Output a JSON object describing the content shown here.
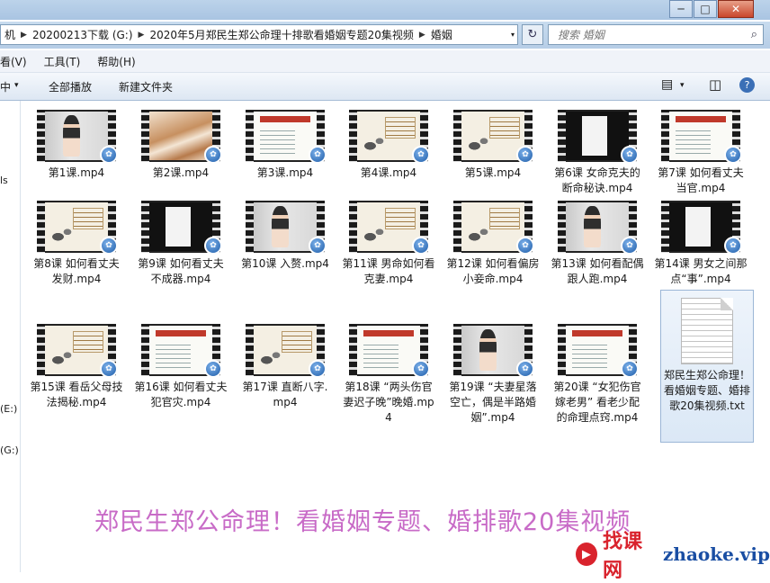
{
  "window": {
    "min_label": "─",
    "max_label": "□",
    "close_label": "✕"
  },
  "address": {
    "crumbs": [
      "机",
      "20200213下载 (G:)",
      "2020年5月郑民生郑公命理十排歌看婚姻专题20集视频",
      "婚姻"
    ],
    "dropdown_glyph": "▾",
    "refresh_glyph": "↻"
  },
  "search": {
    "placeholder": "搜索 婚姻",
    "icon": "search-icon",
    "glyph": "⌕"
  },
  "menu": [
    "看(V)",
    "工具(T)",
    "帮助(H)"
  ],
  "toolbar": {
    "left_label": "中",
    "left_arrow": "▾",
    "play_all": "全部播放",
    "new_folder": "新建文件夹",
    "help_glyph": "?",
    "view_glyph": "▤",
    "pane_glyph": "◫"
  },
  "navpane": {
    "items": [
      "ls",
      "(E:)",
      "(G:)"
    ]
  },
  "files": [
    {
      "name": "第1课.mp4",
      "thumb": "woman"
    },
    {
      "name": "第2课.mp4",
      "thumb": "silk"
    },
    {
      "name": "第3课.mp4",
      "thumb": "doc"
    },
    {
      "name": "第4课.mp4",
      "thumb": "ink"
    },
    {
      "name": "第5课.mp4",
      "thumb": "ink"
    },
    {
      "name": "第6课 女命克夫的断命秘诀.mp4",
      "thumb": "dark"
    },
    {
      "name": "第7课 如何看丈夫当官.mp4",
      "thumb": "doc"
    },
    {
      "name": "第8课 如何看丈夫发财.mp4",
      "thumb": "ink"
    },
    {
      "name": "第9课 如何看丈夫不成器.mp4",
      "thumb": "dark"
    },
    {
      "name": "第10课 入赘.mp4",
      "thumb": "woman"
    },
    {
      "name": "第11课 男命如何看克妻.mp4",
      "thumb": "ink"
    },
    {
      "name": "第12课 如何看偏房小妾命.mp4",
      "thumb": "ink"
    },
    {
      "name": "第13课 如何看配偶跟人跑.mp4",
      "thumb": "woman"
    },
    {
      "name": "第14课 男女之间那点“事”.mp4",
      "thumb": "dark"
    },
    {
      "name": "第15课 看岳父母技法揭秘.mp4",
      "thumb": "ink"
    },
    {
      "name": "第16课 如何看丈夫犯官灾.mp4",
      "thumb": "doc"
    },
    {
      "name": "第17课 直断八字.mp4",
      "thumb": "ink"
    },
    {
      "name": "第18课 “两头伤官 妻迟子晚”晚婚.mp4",
      "thumb": "doc"
    },
    {
      "name": "第19课 “夫妻星落空亡，偶是半路婚姻”.mp4",
      "thumb": "woman"
    },
    {
      "name": "第20课 “女犯伤官嫁老男” 看老少配的命理点窍.mp4",
      "thumb": "doc"
    }
  ],
  "textfile": {
    "name": "郑民生郑公命理！看婚姻专题、婚排歌20集视频.txt"
  },
  "promo": "郑民生郑公命理！看婚姻专题、婚排歌20集视频",
  "watermark": {
    "logo": "▶",
    "cn": "找课网",
    "url": "zhaoke.vip"
  },
  "colors": {
    "promo": "#c86bc7",
    "watermark_red": "#d9232d",
    "watermark_blue": "#1a4ea3"
  }
}
